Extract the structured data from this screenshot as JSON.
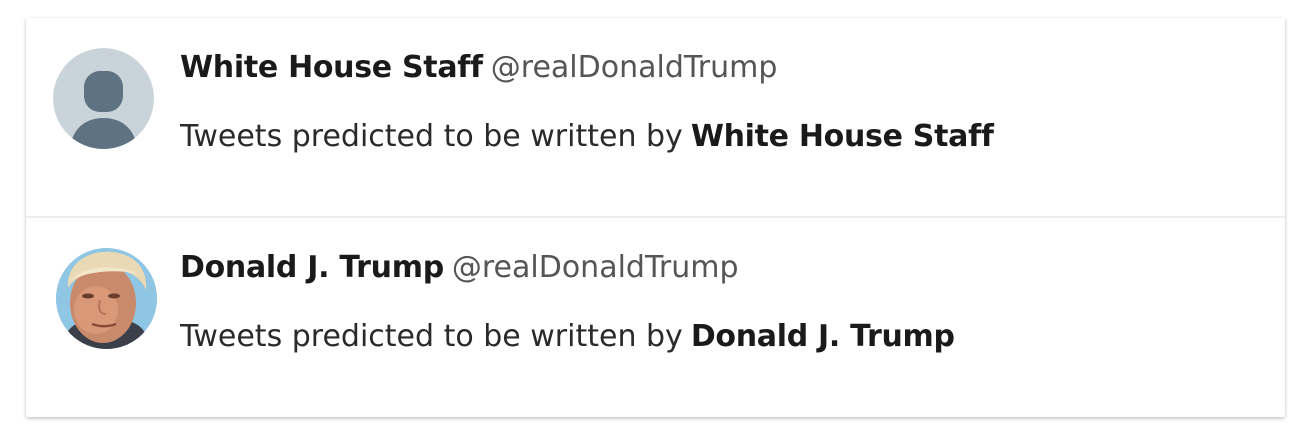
{
  "accounts": [
    {
      "display_name": "White House Staff",
      "handle": "@realDonaldTrump",
      "description_prefix": "Tweets predicted to be written by",
      "description_name": "White House Staff",
      "avatar_icon": "default-user-icon",
      "avatar_colors": {
        "background": "#c9d3da",
        "figure": "#5f7282"
      }
    },
    {
      "display_name": "Donald J. Trump",
      "handle": "@realDonaldTrump",
      "description_prefix": "Tweets predicted to be written by",
      "description_name": "Donald J. Trump",
      "avatar_icon": "profile-photo",
      "avatar_colors": {
        "background": "#9fd3ee",
        "skin": "#c98a6c",
        "hair": "#e9d9b5"
      }
    }
  ]
}
